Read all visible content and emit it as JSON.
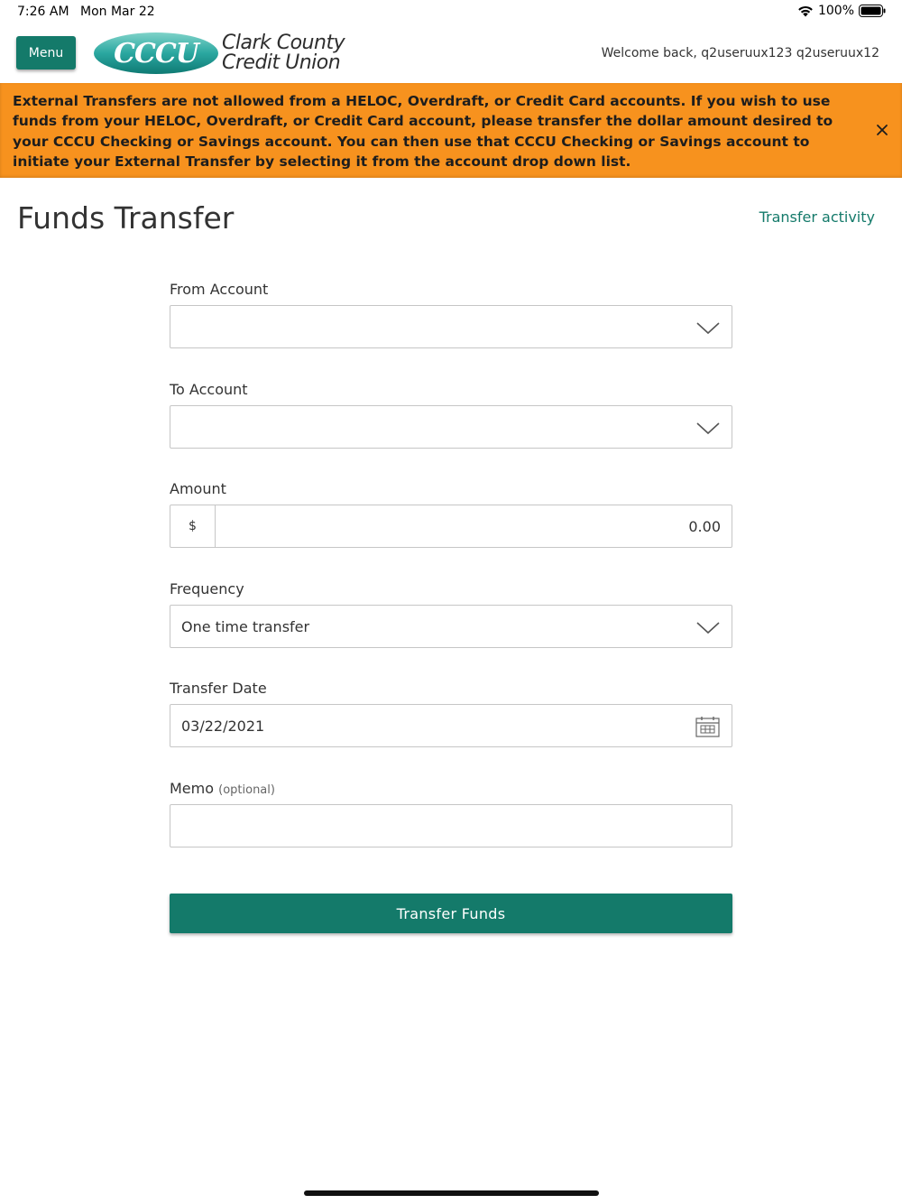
{
  "status_bar": {
    "time": "7:26 AM",
    "date": "Mon Mar 22",
    "battery": "100%"
  },
  "header": {
    "menu_label": "Menu",
    "logo_text": "CCCU",
    "brand_line1": "Clark County",
    "brand_line2": "Credit Union",
    "welcome": "Welcome back, q2useruux123 q2useruux12"
  },
  "alert": {
    "message": "External Transfers are not allowed from a HELOC, Overdraft, or Credit Card accounts. If you wish to use funds from your HELOC, Overdraft, or Credit Card account, please transfer the dollar amount desired to your CCCU Checking or Savings account. You can then use that CCCU Checking or Savings account to initiate your External Transfer by selecting it from the account drop down list."
  },
  "page": {
    "title": "Funds Transfer",
    "activity_link": "Transfer activity"
  },
  "form": {
    "from_account": {
      "label": "From Account",
      "value": ""
    },
    "to_account": {
      "label": "To Account",
      "value": ""
    },
    "amount": {
      "label": "Amount",
      "currency": "$",
      "value": "0.00"
    },
    "frequency": {
      "label": "Frequency",
      "value": "One time transfer"
    },
    "transfer_date": {
      "label": "Transfer Date",
      "value": "03/22/2021"
    },
    "memo": {
      "label": "Memo",
      "optional": "(optional)",
      "value": ""
    },
    "submit_label": "Transfer Funds"
  },
  "colors": {
    "brand_green": "#147a6a",
    "alert_orange": "#f7921e",
    "logo_teal": "#2aa7a0"
  },
  "icons": {
    "status": [
      "wifi-icon",
      "battery-icon"
    ],
    "alert_close": "close-icon",
    "dropdown": "chevron-down-icon",
    "date": "calendar-icon"
  }
}
